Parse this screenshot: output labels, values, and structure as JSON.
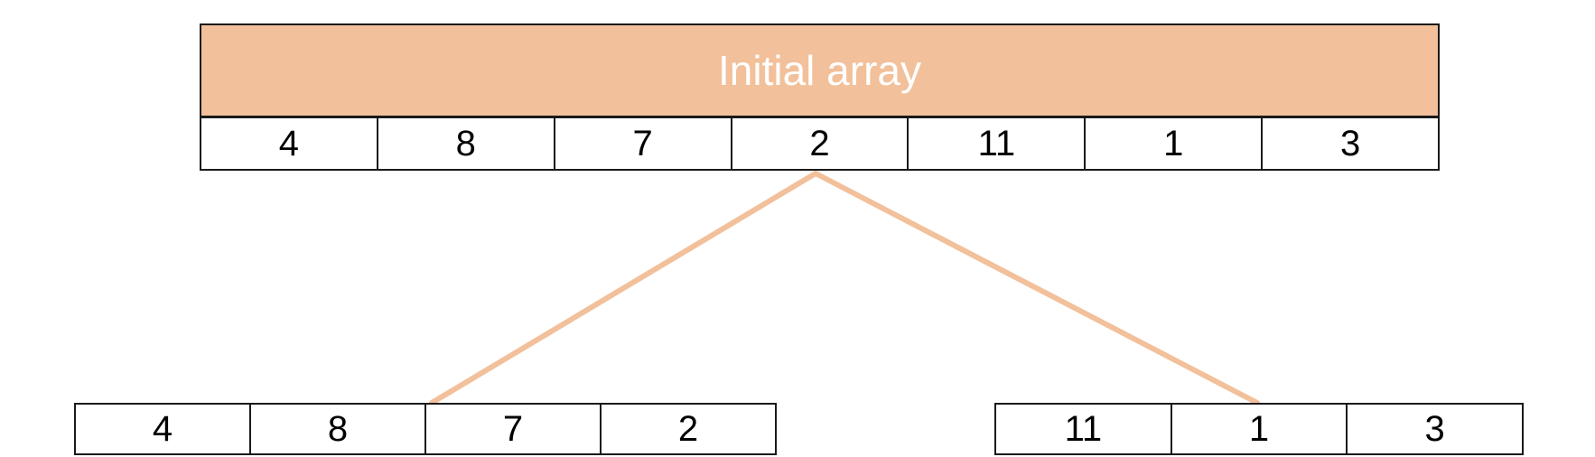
{
  "header": {
    "title": "Initial array"
  },
  "initial_array": [
    "4",
    "8",
    "7",
    "2",
    "11",
    "1",
    "3"
  ],
  "left_array": [
    "4",
    "8",
    "7",
    "2"
  ],
  "right_array": [
    "11",
    "1",
    "3"
  ],
  "colors": {
    "accent": "#f2c09a",
    "border": "#1a1a1a",
    "header_text": "#ffffff"
  }
}
